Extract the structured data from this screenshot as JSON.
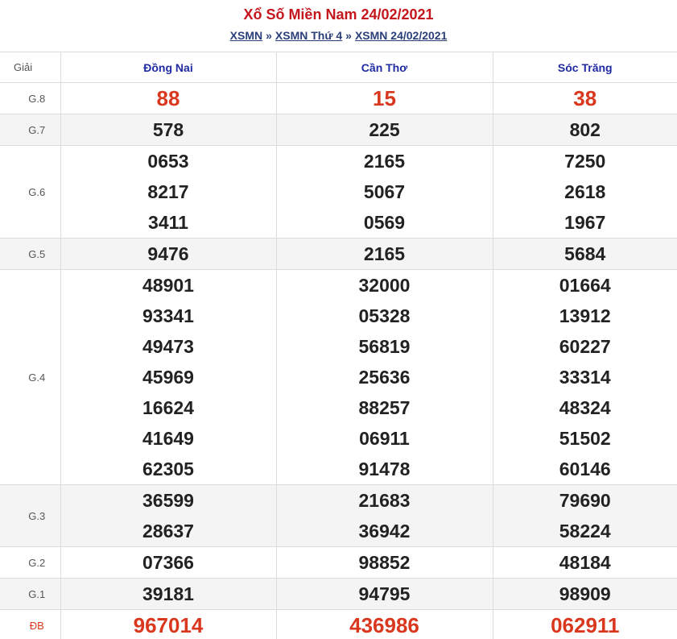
{
  "header": {
    "title": "Xổ Số Miền Nam 24/02/2021",
    "breadcrumb": [
      "XSMN",
      "XSMN Thứ 4",
      "XSMN 24/02/2021"
    ],
    "separator": "»"
  },
  "table": {
    "label_header": "Giải",
    "provinces": [
      "Đồng Nai",
      "Cần Thơ",
      "Sóc Trăng"
    ],
    "rows": [
      {
        "label": "G.8",
        "values": [
          [
            "88"
          ],
          [
            "15"
          ],
          [
            "38"
          ]
        ]
      },
      {
        "label": "G.7",
        "values": [
          [
            "578"
          ],
          [
            "225"
          ],
          [
            "802"
          ]
        ]
      },
      {
        "label": "G.6",
        "values": [
          [
            "0653",
            "8217",
            "3411"
          ],
          [
            "2165",
            "5067",
            "0569"
          ],
          [
            "7250",
            "2618",
            "1967"
          ]
        ]
      },
      {
        "label": "G.5",
        "values": [
          [
            "9476"
          ],
          [
            "2165"
          ],
          [
            "5684"
          ]
        ]
      },
      {
        "label": "G.4",
        "values": [
          [
            "48901",
            "93341",
            "49473",
            "45969",
            "16624",
            "41649",
            "62305"
          ],
          [
            "32000",
            "05328",
            "56819",
            "25636",
            "88257",
            "06911",
            "91478"
          ],
          [
            "01664",
            "13912",
            "60227",
            "33314",
            "48324",
            "51502",
            "60146"
          ]
        ]
      },
      {
        "label": "G.3",
        "values": [
          [
            "36599",
            "28637"
          ],
          [
            "21683",
            "36942"
          ],
          [
            "79690",
            "58224"
          ]
        ]
      },
      {
        "label": "G.2",
        "values": [
          [
            "07366"
          ],
          [
            "98852"
          ],
          [
            "48184"
          ]
        ]
      },
      {
        "label": "G.1",
        "values": [
          [
            "39181"
          ],
          [
            "94795"
          ],
          [
            "98909"
          ]
        ]
      },
      {
        "label": "ĐB",
        "values": [
          [
            "967014"
          ],
          [
            "436986"
          ],
          [
            "062911"
          ]
        ]
      }
    ]
  },
  "colors": {
    "title": "#c4161c",
    "breadcrumb": "#2a3f7a",
    "province": "#1f2aa3",
    "highlight": "#d9381e"
  }
}
